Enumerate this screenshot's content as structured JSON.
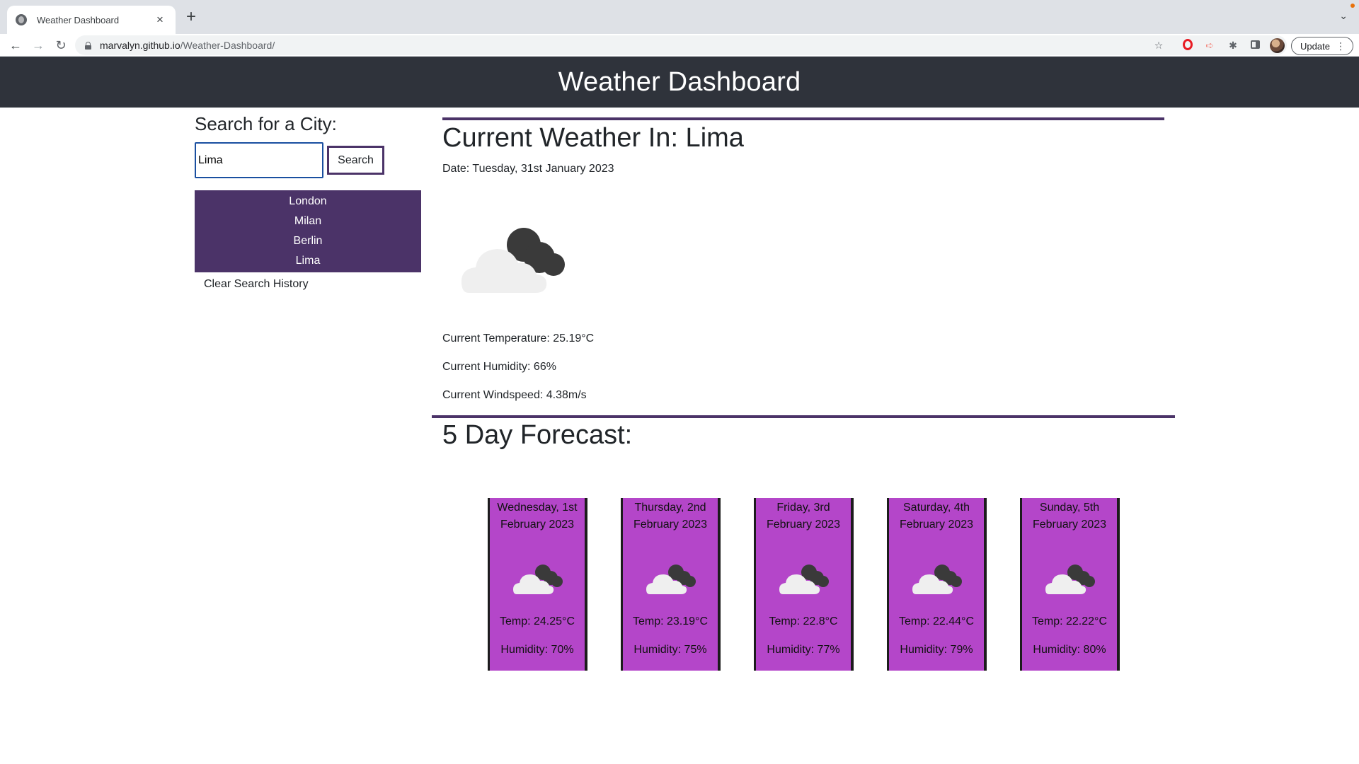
{
  "browser": {
    "tab_title": "Weather Dashboard",
    "url_host": "marvalyn.github.io",
    "url_path": "/Weather-Dashboard/",
    "update_label": "Update"
  },
  "header": {
    "title": "Weather Dashboard"
  },
  "search": {
    "heading": "Search for a City:",
    "input_value": "Lima",
    "button_label": "Search",
    "history": [
      "London",
      "Milan",
      "Berlin",
      "Lima"
    ],
    "clear_label": "Clear Search History"
  },
  "current": {
    "title": "Current Weather In: Lima",
    "date": "Date: Tuesday, 31st January 2023",
    "icon": "partly-cloudy-night-icon",
    "temperature": "Current Temperature: 25.19°C",
    "humidity": "Current Humidity: 66%",
    "windspeed": "Current Windspeed: 4.38m/s"
  },
  "forecast": {
    "title": "5 Day Forecast:",
    "days": [
      {
        "date": "Wednesday, 1st February 2023",
        "icon": "partly-cloudy-night-icon",
        "temp": "Temp: 24.25°C",
        "humidity": "Humidity: 70%"
      },
      {
        "date": "Thursday, 2nd February 2023",
        "icon": "partly-cloudy-night-icon",
        "temp": "Temp: 23.19°C",
        "humidity": "Humidity: 75%"
      },
      {
        "date": "Friday, 3rd February 2023",
        "icon": "partly-cloudy-night-icon",
        "temp": "Temp: 22.8°C",
        "humidity": "Humidity: 77%"
      },
      {
        "date": "Saturday, 4th February 2023",
        "icon": "partly-cloudy-night-icon",
        "temp": "Temp: 22.44°C",
        "humidity": "Humidity: 79%"
      },
      {
        "date": "Sunday, 5th February 2023",
        "icon": "partly-cloudy-night-icon",
        "temp": "Temp: 22.22°C",
        "humidity": "Humidity: 80%"
      }
    ]
  },
  "colors": {
    "header_bg": "#2f333b",
    "accent_purple": "#4b3368",
    "card_bg": "#b446c9"
  }
}
